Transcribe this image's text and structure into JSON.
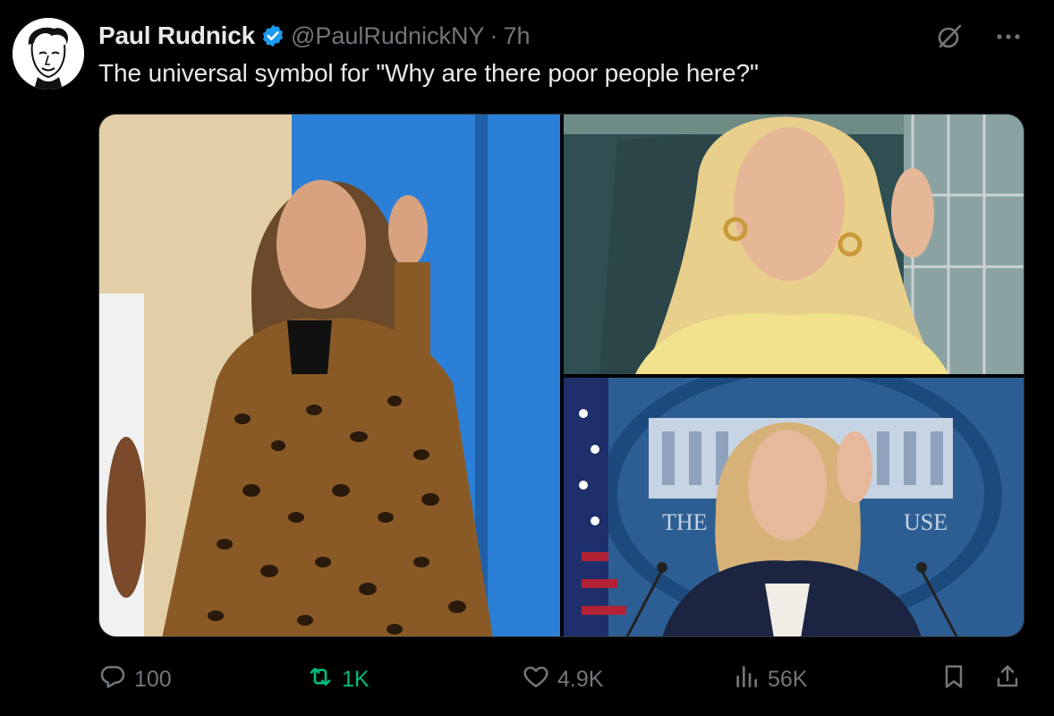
{
  "author": {
    "name": "Paul Rudnick",
    "handle": "@PaulRudnickNY",
    "separator": "·",
    "time": "7h",
    "avatar_icon": "caricature-avatar",
    "verified_icon": "verified-badge-icon"
  },
  "tweet": {
    "text": "The universal symbol for \"Why are there poor people here?\""
  },
  "media": [
    {
      "icon": "photo-woman-leopard-coat"
    },
    {
      "icon": "photo-woman-blonde-yellow-top"
    },
    {
      "icon": "photo-woman-press-briefing"
    }
  ],
  "metrics": {
    "replies": "100",
    "reposts": "1K",
    "likes": "4.9K",
    "views": "56K"
  },
  "colors": {
    "background": "#000000",
    "text": "#e7e9ea",
    "muted": "#71767b",
    "verified": "#1d9bf0",
    "repost_active": "#00ba7c"
  }
}
